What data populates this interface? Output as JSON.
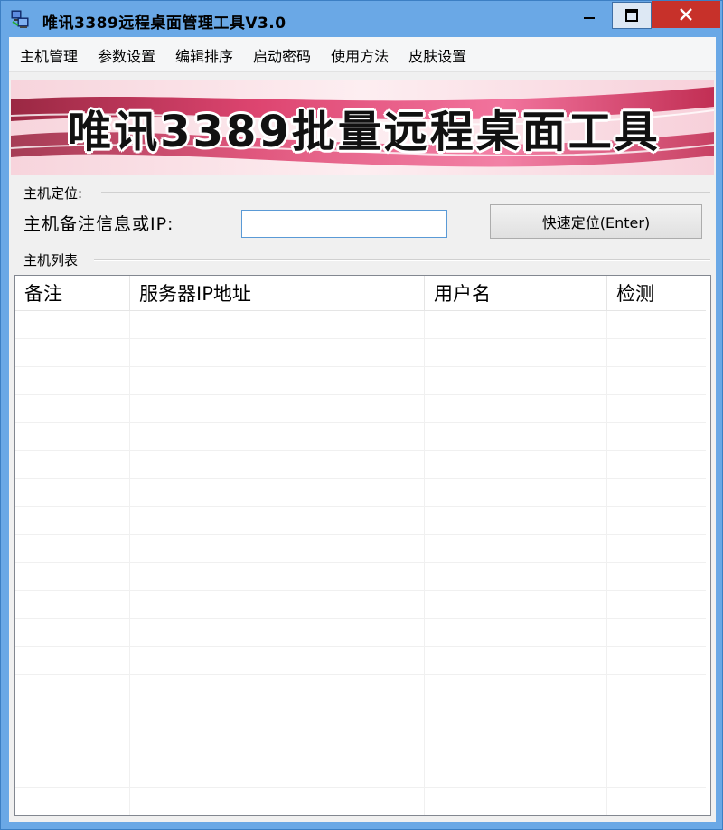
{
  "window": {
    "title": "唯讯3389远程桌面管理工具V3.0",
    "accent": "#6aa8e6",
    "close_color": "#c7312a"
  },
  "menu": {
    "items": [
      "主机管理",
      "参数设置",
      "编辑排序",
      "启动密码",
      "使用方法",
      "皮肤设置"
    ]
  },
  "banner": {
    "title": "唯讯3389批量远程桌面工具"
  },
  "locate": {
    "group_label": "主机定位:",
    "field_label": "主机备注信息或IP:",
    "input_value": "",
    "button_label": "快速定位(Enter)"
  },
  "host_list": {
    "group_label": "主机列表",
    "columns": [
      "备注",
      "服务器IP地址",
      "用户名",
      "检测"
    ],
    "rows": []
  }
}
